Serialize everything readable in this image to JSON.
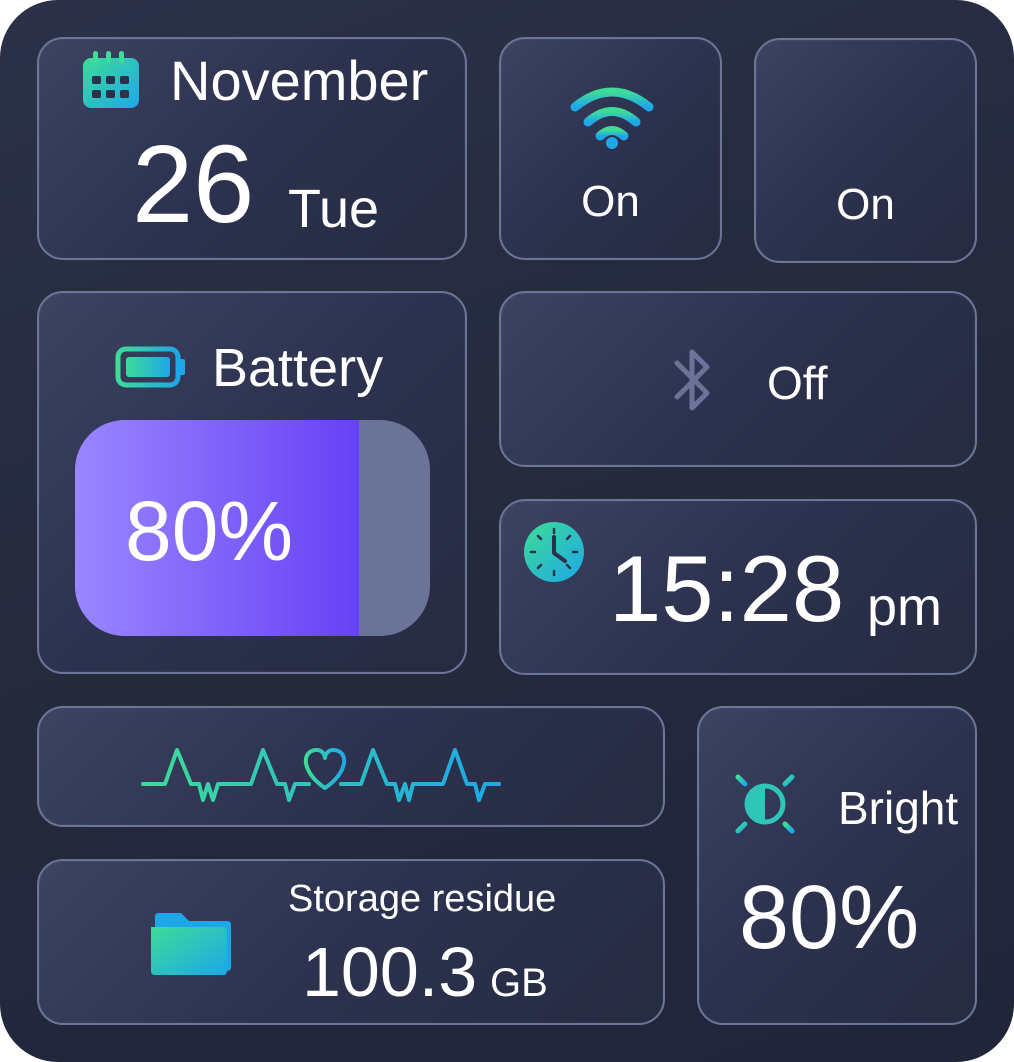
{
  "date": {
    "month": "November",
    "day": "26",
    "weekday": "Tue"
  },
  "wifi": {
    "status": "On",
    "icon": "wifi-icon"
  },
  "cellular": {
    "status": "On",
    "icon": "signal-bars-icon"
  },
  "battery": {
    "title": "Battery",
    "level_text": "80%",
    "level": 0.8,
    "icon": "battery-icon"
  },
  "bluetooth": {
    "status": "Off",
    "icon": "bluetooth-icon"
  },
  "clock": {
    "time": "15:28",
    "period": "pm",
    "icon": "clock-icon"
  },
  "heart_rate": {
    "icon": "heartbeat-icon"
  },
  "storage": {
    "title": "Storage residue",
    "value": "100.3",
    "unit": "GB",
    "icon": "folder-icon"
  },
  "brightness": {
    "title": "Bright",
    "level_text": "80%",
    "icon": "brightness-icon"
  },
  "colors": {
    "accent_start": "#3ddc97",
    "accent_end": "#1ea7e8",
    "battery_start": "#9a86ff",
    "battery_end": "#6741f5",
    "battery_empty": "#6b7399"
  }
}
